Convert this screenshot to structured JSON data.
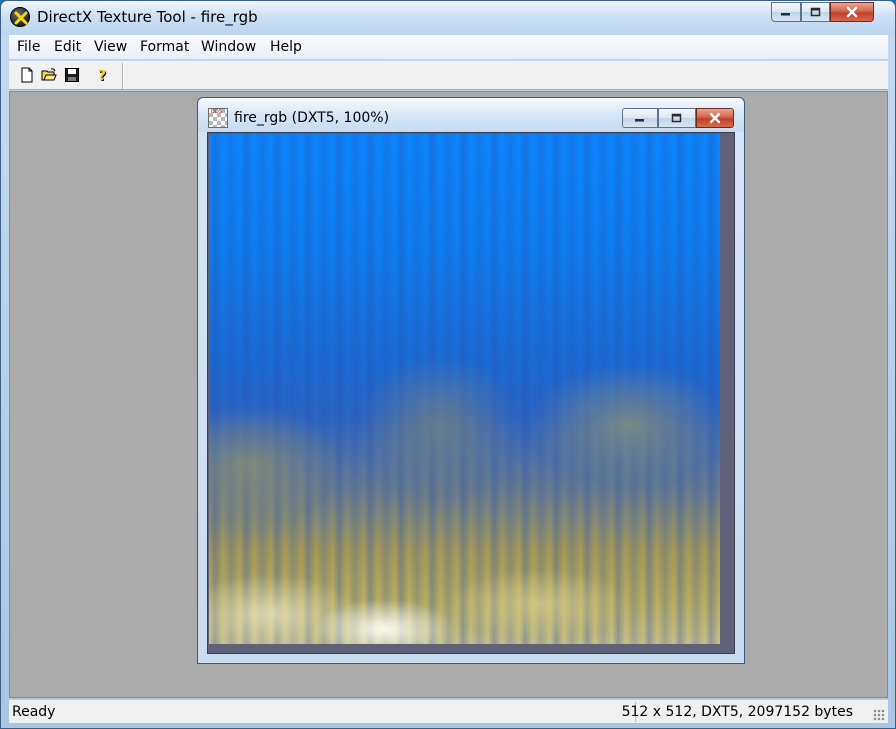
{
  "window": {
    "title": "DirectX Texture Tool - fire_rgb",
    "app_icon": "directx-x-icon",
    "buttons": [
      "minimize-icon",
      "maximize-icon",
      "close-icon"
    ]
  },
  "menu": {
    "items": [
      {
        "label": "File"
      },
      {
        "label": "Edit"
      },
      {
        "label": "View"
      },
      {
        "label": "Format"
      },
      {
        "label": "Window"
      },
      {
        "label": "Help"
      }
    ]
  },
  "toolbar": {
    "icons": [
      "new-file-icon",
      "open-folder-icon",
      "save-disk-icon",
      "help-question-icon"
    ]
  },
  "document": {
    "title": "fire_rgb (DXT5, 100%)",
    "icon": "dds-texture-icon",
    "icon_tag": "DDS",
    "colors": {
      "sky": "#0a86ff",
      "fire_yellow": "#bcb060",
      "frame": "#5f6179"
    }
  },
  "status": {
    "left": "Ready",
    "right": "512 x 512, DXT5, 2097152 bytes"
  }
}
